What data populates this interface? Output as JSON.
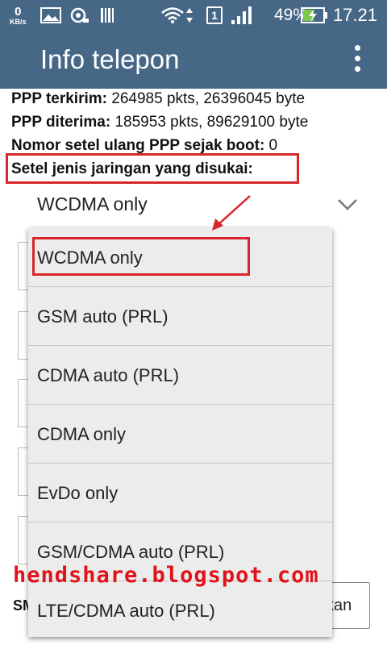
{
  "status_bar": {
    "speed_value": "0",
    "speed_unit": "KB/s",
    "sim_slot": "1",
    "battery_percent": "49%",
    "time": "17.21"
  },
  "app_bar": {
    "title": "Info telepon"
  },
  "info": {
    "ppp_sent_label": "PPP terkirim:",
    "ppp_sent_value": " 264985 pkts, 26396045 byte",
    "ppp_received_label": "PPP diterima:",
    "ppp_received_value": " 185953 pkts, 89629100 byte",
    "ppp_reset_label": "Nomor setel ulang PPP sejak boot:",
    "ppp_reset_value": " 0",
    "preferred_network_label": "Setel jenis jaringan yang disukai:"
  },
  "network_type_spinner": {
    "selected": "WCDMA only",
    "options": [
      "WCDMA only",
      "GSM auto (PRL)",
      "CDMA auto (PRL)",
      "CDMA only",
      "EvDo only",
      "GSM/CDMA auto (PRL)",
      "LTE/CDMA auto (PRL)"
    ]
  },
  "background": {
    "sms_label": "SM",
    "button_label_fragment": "kan"
  },
  "watermark": "hendshare.blogspot.com",
  "colors": {
    "app_bar": "#466886",
    "highlight_box": "#d8262a",
    "watermark": "#e0121a",
    "dropdown_bg": "#ececec"
  }
}
